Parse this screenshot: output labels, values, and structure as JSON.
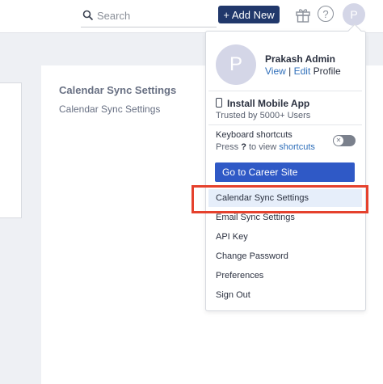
{
  "topbar": {
    "search_placeholder": "Search",
    "add_new_label": "+ Add New",
    "help_glyph": "?",
    "avatar_initial": "P",
    "icons": [
      "search-icon",
      "gift-icon",
      "help-icon"
    ]
  },
  "main": {
    "title": "Calendar Sync Settings",
    "subtitle": "Calendar Sync Settings"
  },
  "dropdown": {
    "avatar_initial": "P",
    "user_name": "Prakash Admin",
    "view_link": "View",
    "link_separator": " | ",
    "edit_link": "Edit",
    "profile_word": " Profile",
    "mobile_title": "Install Mobile App",
    "mobile_subtitle": "Trusted by 5000+ Users",
    "shortcuts_title": "Keyboard shortcuts",
    "shortcuts_press": "Press ",
    "shortcuts_key": "?",
    "shortcuts_to_view": " to view ",
    "shortcuts_link": "shortcuts",
    "toggle_off_glyph": "✕",
    "career_button": "Go to Career Site",
    "menu_items": [
      "Calendar Sync Settings",
      "Email Sync Settings",
      "API Key",
      "Change Password",
      "Preferences",
      "Sign Out"
    ],
    "selected_item": "Calendar Sync Settings"
  },
  "colors": {
    "add_new_bg": "#21386b",
    "career_button_bg": "#2f59c6",
    "link": "#2f6fba",
    "highlight": "#e5412d",
    "selected_item_bg": "#e6eefa"
  }
}
